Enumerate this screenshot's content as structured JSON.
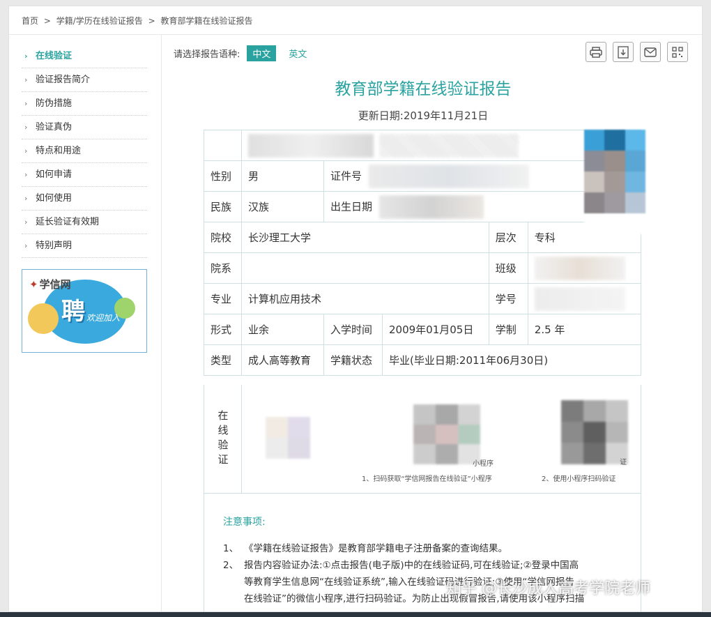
{
  "breadcrumb": {
    "home": "首页",
    "sep": ">",
    "level2": "学籍/学历在线验证报告",
    "current": "教育部学籍在线验证报告"
  },
  "sidebar": {
    "items": [
      {
        "label": "在线验证"
      },
      {
        "label": "验证报告简介"
      },
      {
        "label": "防伪措施"
      },
      {
        "label": "验证真伪"
      },
      {
        "label": "特点和用途"
      },
      {
        "label": "如何申请"
      },
      {
        "label": "如何使用"
      },
      {
        "label": "延长验证有效期"
      },
      {
        "label": "特别声明"
      }
    ],
    "arrow": "›",
    "ad": {
      "brand": "学信网",
      "big": "聘",
      "slogan": "欢迎加入"
    }
  },
  "lang": {
    "prompt": "请选择报告语种:",
    "zh": "中文",
    "en": "英文"
  },
  "tools": {
    "print": "print-icon",
    "download": "pdf-download-icon",
    "mail": "mail-icon",
    "qrcode": "qrcode-icon"
  },
  "report": {
    "title": "教育部学籍在线验证报告",
    "update_date": "更新日期:2019年11月21日",
    "labels": {
      "gender": "性别",
      "idno": "证件号",
      "ethnicity": "民族",
      "birth": "出生日期",
      "school": "院校",
      "level": "层次",
      "dept": "院系",
      "class": "班级",
      "major": "专业",
      "studentno": "学号",
      "form": "形式",
      "enroll": "入学时间",
      "duration": "学制",
      "type": "类型",
      "status": "学籍状态",
      "verify": "在线验证"
    },
    "values": {
      "gender": "男",
      "ethnicity": "汉族",
      "school": "长沙理工大学",
      "level": "专科",
      "major": "计算机应用技术",
      "form": "业余",
      "enroll": "2009年01月05日",
      "duration": "2.5 年",
      "type": "成人高等教育",
      "status": "毕业(毕业日期:2011年06月30日)"
    },
    "verify": {
      "caption1": "1、扫码获取“学信网报告在线验证”小程序",
      "caption2": "2、使用小程序扫码验证",
      "sub1": "小程序",
      "sub2": "证"
    }
  },
  "notice": {
    "title": "注意事项:",
    "items": [
      {
        "num": "1、",
        "text": "《学籍在线验证报告》是教育部学籍电子注册备案的查询结果。"
      },
      {
        "num": "2、",
        "text": "报告内容验证办法:①点击报告(电子版)中的在线验证码,可在线验证;②登录中国高"
      },
      {
        "num": "",
        "text": "等教育学生信息网“在线验证系统”,输入在线验证码进行验证;③使用“学信网报告"
      },
      {
        "num": "",
        "text": "在线验证”的微信小程序,进行扫码验证。为防止出现假冒报告,请使用该小程序扫描"
      }
    ]
  },
  "watermark": "知乎 @长沙成人高考学院老师"
}
